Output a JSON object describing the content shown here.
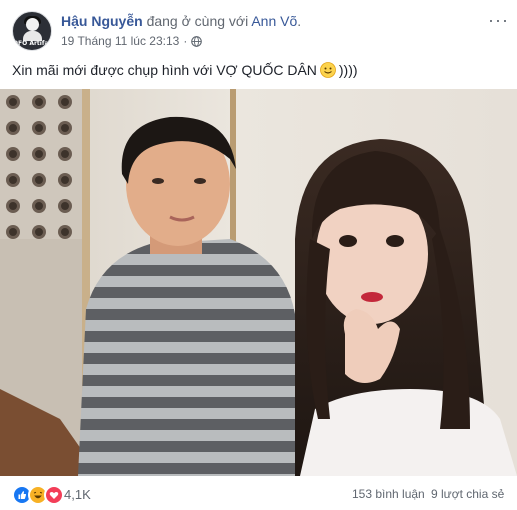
{
  "post": {
    "author": "Hậu Nguyễn",
    "with_text": " đang ở cùng với ",
    "tagged_friend": "Ann Võ",
    "tagged_suffix": ".",
    "timestamp": "19 Tháng 11 lúc 23:13",
    "separator": "·",
    "privacy_icon": "globe-icon",
    "more_icon": "···",
    "avatar_tag": "ĐFO Artifact",
    "text": "Xin mãi mới được chụp hình với VỢ QUỐC DÂN",
    "text_suffix": "))))",
    "emoji": "slightly-smiling-face"
  },
  "footer": {
    "reaction_icons": [
      "like-reaction-icon",
      "haha-reaction-icon",
      "love-reaction-icon"
    ],
    "reaction_count": "4,1K",
    "comment_count": "153 bình luận",
    "share_count": "9 lượt chia sẻ"
  },
  "colors": {
    "link": "#385898",
    "meta": "#616770",
    "like": "#1877f2",
    "haha": "#f7b125",
    "love": "#f33e58"
  }
}
